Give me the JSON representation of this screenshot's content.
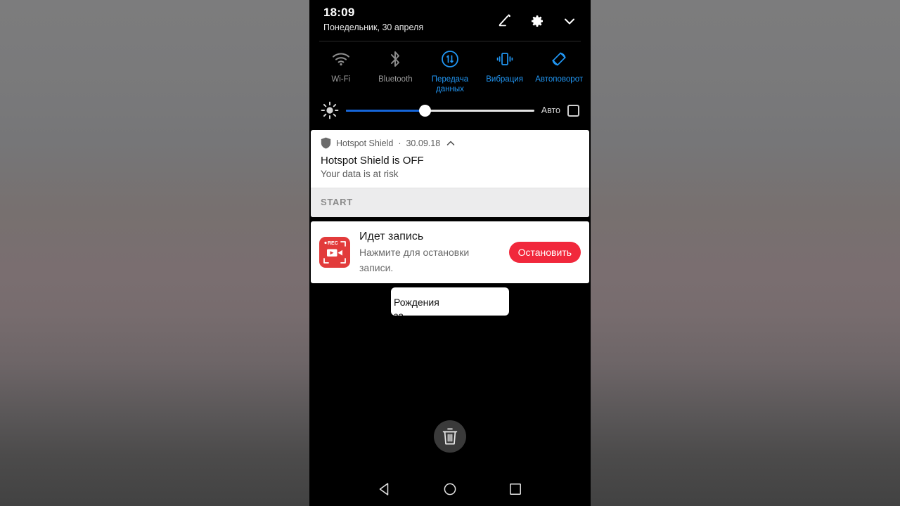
{
  "status": {
    "time": "18:09",
    "date": "Понедельник, 30 апреля"
  },
  "header_icons": [
    {
      "name": "edit-icon",
      "label": "Изменить"
    },
    {
      "name": "gear-icon",
      "label": "Настройки"
    },
    {
      "name": "chevron-down-icon",
      "label": "Свернуть"
    }
  ],
  "quick_settings": {
    "tiles": [
      {
        "label": "Wi-Fi",
        "icon": "wifi-icon",
        "state": "off"
      },
      {
        "label": "Bluetooth",
        "icon": "bluetooth-icon",
        "state": "off"
      },
      {
        "label": "Передача данных",
        "icon": "data-transfer-icon",
        "state": "on"
      },
      {
        "label": "Вибрация",
        "icon": "vibration-icon",
        "state": "on"
      },
      {
        "label": "Автоповорот",
        "icon": "auto-rotate-icon",
        "state": "on"
      }
    ],
    "brightness": {
      "icon": "brightness-icon",
      "value_percent": 42,
      "auto_label": "Авто",
      "auto_checked": false
    },
    "colors": {
      "active": "#2196f3",
      "inactive": "#9b9b9b",
      "slider_fill": "#1565d8"
    }
  },
  "notifications": [
    {
      "app": "Hotspot Shield",
      "separator": "·",
      "timestamp": "30.09.18",
      "icon": "shield-icon",
      "collapse_icon": "chevron-up-icon",
      "title": "Hotspot Shield is OFF",
      "subtitle": "Your data is at risk",
      "action": "START"
    },
    {
      "icon": "screen-recorder-icon",
      "icon_badge": "REC",
      "title": "Идет запись",
      "subtitle": "Нажмите для остановки записи.",
      "button": "Остановить",
      "button_color": "#f1283c"
    },
    {
      "clipped": true,
      "line1": "Рождения",
      "line2": "за"
    }
  ],
  "clear_all": {
    "icon": "trash-icon",
    "label": "Очистить все"
  },
  "navbar": [
    {
      "name": "back-button",
      "icon": "triangle-left-icon",
      "label": "Назад"
    },
    {
      "name": "home-button",
      "icon": "circle-icon",
      "label": "Главный экран"
    },
    {
      "name": "recents-button",
      "icon": "square-icon",
      "label": "Обзор"
    }
  ]
}
